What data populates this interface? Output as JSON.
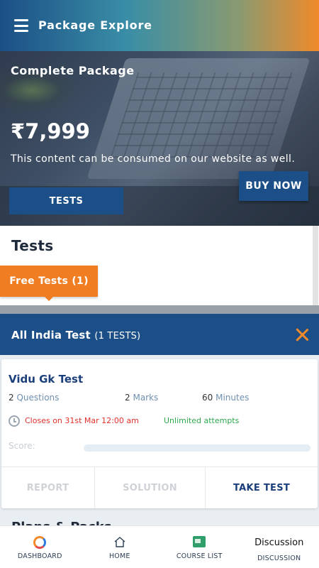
{
  "appbar": {
    "title": "Package Explore",
    "menu_icon": "hamburger-menu-icon"
  },
  "hero": {
    "title": "Complete Package",
    "price": "₹7,999",
    "note": "This content can be consumed on our website as well.",
    "buy_label": "BUY NOW",
    "tab_label": "TESTS"
  },
  "section": {
    "title": "Tests",
    "free_badge": "Free Tests (1)"
  },
  "modal": {
    "title": "All India Test",
    "count": "(1 TESTS)",
    "close_icon": "close-icon",
    "card": {
      "title": "Vidu Gk Test",
      "questions_value": "2",
      "questions_unit": "Questions",
      "marks_value": "2",
      "marks_unit": "Marks",
      "minutes_value": "60",
      "minutes_unit": "Minutes",
      "closes": "Closes on 31st Mar 12:00 am",
      "attempts": "Unlimited attempts",
      "score_label": "Score:",
      "score_fraction": 0,
      "actions": {
        "report": "REPORT",
        "solution": "SOLUTION",
        "take": "TAKE TEST"
      }
    },
    "peek_text": "Plans & Packs"
  },
  "bottom_nav": {
    "items": [
      {
        "label": "DASHBOARD",
        "icon": "dashboard-icon"
      },
      {
        "label": "HOME",
        "icon": "home-icon"
      },
      {
        "label": "COURSE LIST",
        "icon": "course-list-icon"
      },
      {
        "title": "Discussion",
        "label": "DISCUSSION"
      }
    ]
  },
  "colors": {
    "primary": "#1c4f87",
    "accent": "#f08a2a",
    "danger": "#e0302a",
    "success": "#2fa84f"
  }
}
